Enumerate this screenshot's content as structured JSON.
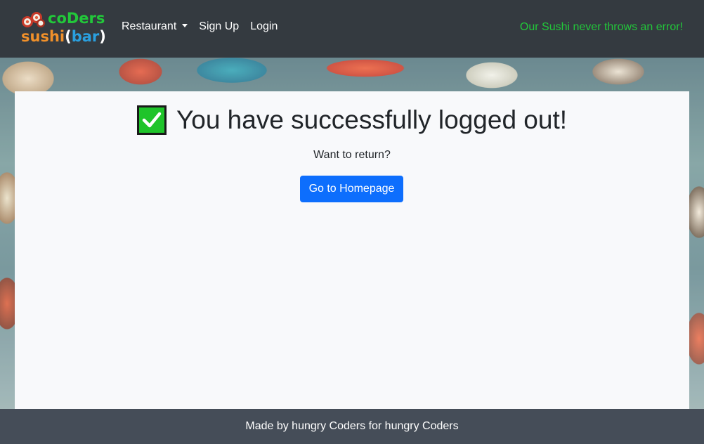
{
  "navbar": {
    "brand_top": "coDers",
    "brand_sushi": "sushi",
    "brand_open": "(",
    "brand_bar": "bar",
    "brand_close": ")",
    "links": {
      "restaurant": "Restaurant",
      "signup": "Sign Up",
      "login": "Login"
    },
    "tagline": "Our Sushi never throws an error!"
  },
  "main": {
    "headline": "You have successfully logged out!",
    "subtext": "Want to return?",
    "home_button": "Go to Homepage"
  },
  "footer": {
    "text": "Made by hungry Coders for hungry Coders"
  },
  "colors": {
    "navbar_bg": "#343a40",
    "tagline": "#22c73a",
    "button": "#0d6efd",
    "footer_bg": "#454d58",
    "check": "#1fc42a"
  },
  "icons": {
    "brand": "sushi-rolls-icon",
    "headline": "check-mark-icon",
    "dropdown": "caret-down-icon"
  }
}
